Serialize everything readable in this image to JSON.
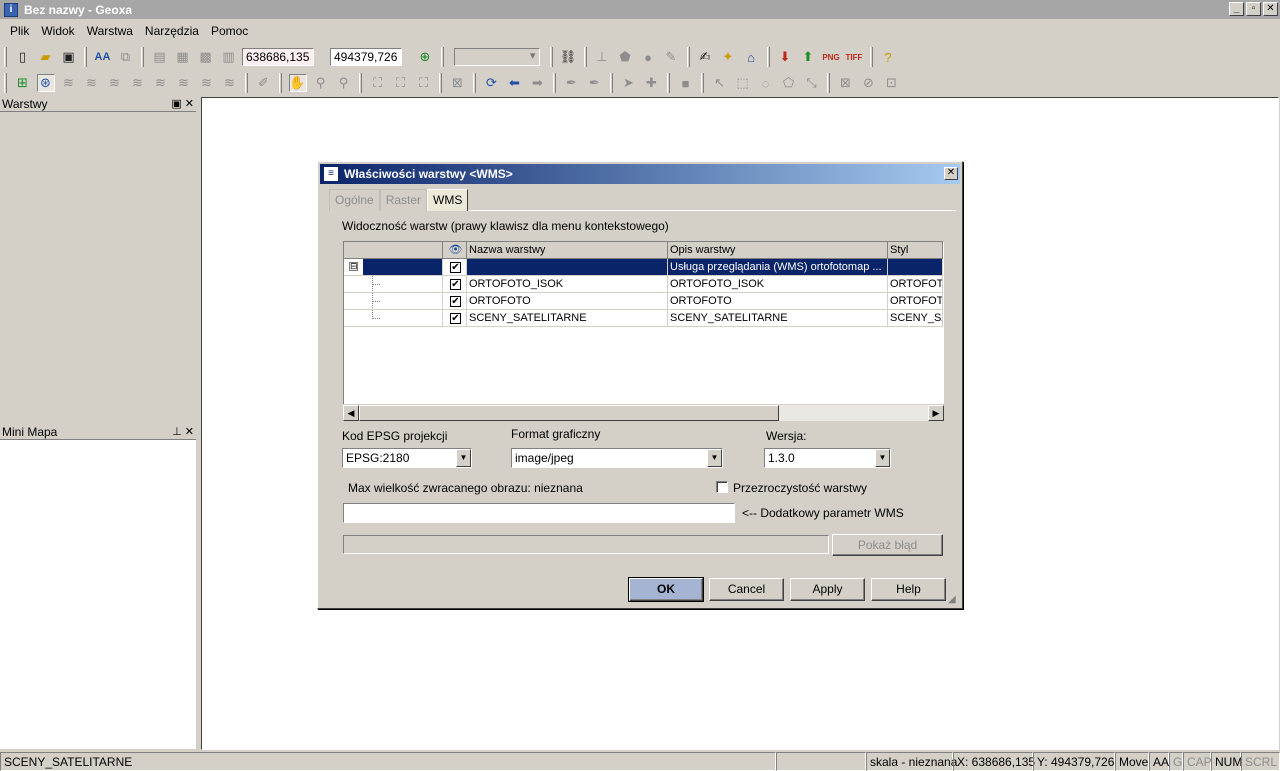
{
  "window": {
    "title": "Bez nazwy - Geoxa",
    "controls": [
      "_",
      "▫",
      "✕"
    ]
  },
  "menu": [
    "Plik",
    "Widok",
    "Warstwa",
    "Narzędzia",
    "Pomoc"
  ],
  "toolbar": {
    "coord_x": "638686,135",
    "coord_y": "494379,726"
  },
  "panes": {
    "layers_title": "Warstwy",
    "minimap_title": "Mini Mapa"
  },
  "status": {
    "layer": "SCENY_SATELITARNE",
    "scale": "skala - nieznana",
    "x": "X: 638686,135",
    "y": "Y: 494379,726",
    "mode": "Move",
    "aa": "AA",
    "g": "G",
    "cap": "CAP",
    "num": "NUM",
    "scrl": "SCRL"
  },
  "dialog": {
    "title": "Właściwości warstwy <WMS>",
    "tabs": [
      "Ogólne",
      "Raster",
      "WMS"
    ],
    "active_tab": "WMS",
    "visibility_label": "Widoczność warstw (prawy klawisz dla menu kontekstowego)",
    "grid": {
      "headers": [
        "",
        "",
        "Nazwa warstwy",
        "Opis warstwy",
        "Styl"
      ],
      "rows": [
        {
          "checked": true,
          "name": "",
          "desc": "Usługa przeglądania (WMS) ortofotomap ...",
          "style": "",
          "selected": true,
          "expander": "⊟"
        },
        {
          "checked": true,
          "name": "ORTOFOTO_ISOK",
          "desc": "ORTOFOTO_ISOK",
          "style": "ORTOFOTO"
        },
        {
          "checked": true,
          "name": "ORTOFOTO",
          "desc": "ORTOFOTO",
          "style": "ORTOFOTO"
        },
        {
          "checked": true,
          "name": "SCENY_SATELITARNE",
          "desc": "SCENY_SATELITARNE",
          "style": "SCENY_SAT"
        }
      ]
    },
    "epsg_label": "Kod EPSG projekcji",
    "epsg_value": "EPSG:2180",
    "format_label": "Format graficzny",
    "format_value": "image/jpeg",
    "version_label": "Wersja:",
    "version_value": "1.3.0",
    "max_size_text": "Max wielkość zwracanego obrazu: nieznana",
    "transparency_label": "Przezroczystość warstwy",
    "transparency_checked": false,
    "extra_param_value": "",
    "extra_param_label": "<-- Dodatkowy parametr WMS",
    "show_error_button": "Pokaż błąd",
    "buttons": {
      "ok": "OK",
      "cancel": "Cancel",
      "apply": "Apply",
      "help": "Help"
    }
  }
}
